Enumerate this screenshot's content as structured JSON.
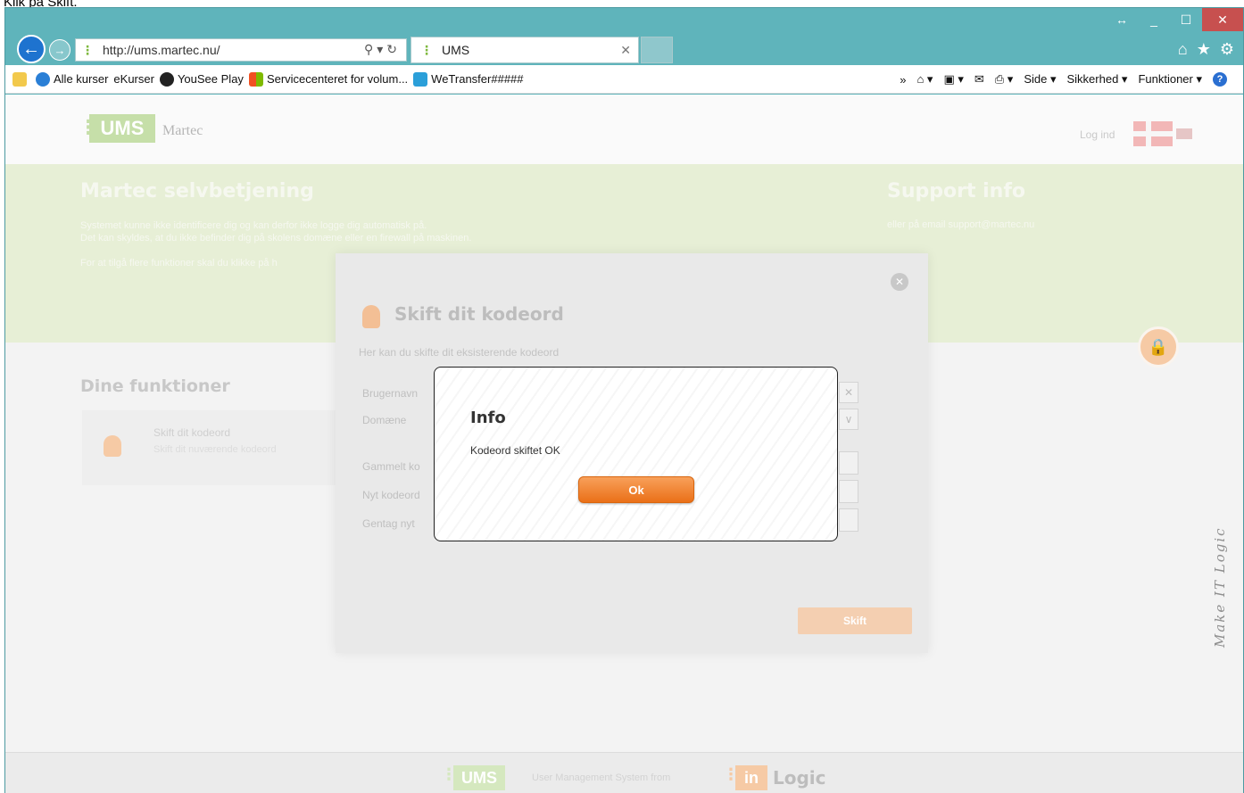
{
  "caption": "Klik på Skift.",
  "browser": {
    "window_controls": {
      "resize": "↔",
      "minimize": "_",
      "maximize": "☐",
      "close": "✕"
    },
    "address": "http://ums.martec.nu/",
    "tab_title": "UMS",
    "right_icons": {
      "home": "⌂",
      "favorites": "★",
      "settings": "⚙"
    },
    "favorites": [
      "Alle kurser",
      "eKurser",
      "YouSee Play",
      "Servicecenteret for volum...",
      "WeTransfer#####"
    ],
    "command_bar": {
      "chevron": "»",
      "page": "Side ▾",
      "safety": "Sikkerhed ▾",
      "tools": "Funktioner ▾",
      "help": "?"
    }
  },
  "site": {
    "logo": "UMS",
    "logo_text": "Martec",
    "login": "Log ind",
    "hero_title": "Martec selvbetjening",
    "hero_lines": [
      "Systemet kunne ikke identificere dig og kan derfor ikke logge dig automatisk på.",
      "Det kan skyldes, at du ikke befinder dig på skolens domæne eller en firewall på maskinen.",
      "",
      "For at tilgå flere funktioner skal du klikke på h"
    ],
    "support_title": "Support info",
    "support_text": "eller på email support@martec.nu",
    "functions_title": "Dine funktioner",
    "function_card": {
      "title": "Skift dit kodeord",
      "subtitle": "Skift dit nuværende kodeord"
    },
    "footer": {
      "ums": "UMS",
      "text": "User Management System from",
      "in": "in",
      "logic": "Logic"
    },
    "side_text": "Make IT Logic"
  },
  "modal": {
    "title": "Skift dit kodeord",
    "subtitle": "Her kan du skifte dit eksisterende kodeord",
    "labels": [
      "Brugernavn",
      "Domæne",
      "Gammelt ko",
      "Nyt kodeord",
      "Gentag nyt"
    ],
    "submit": "Skift"
  },
  "info_dialog": {
    "title": "Info",
    "message": "Kodeord skiftet OK",
    "ok": "Ok"
  }
}
